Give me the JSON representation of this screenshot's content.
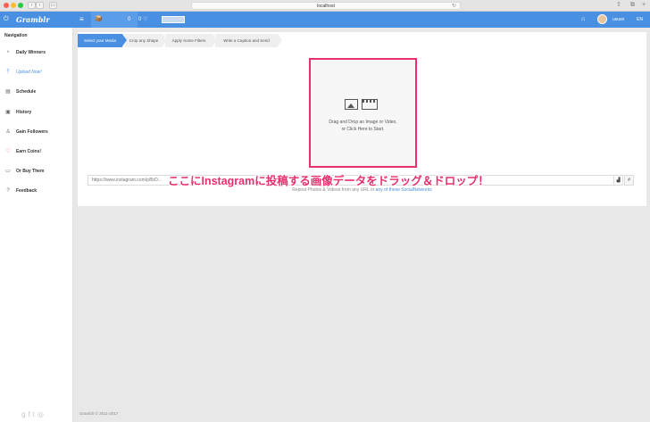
{
  "browser": {
    "url": "localhost"
  },
  "app": {
    "logo": "Gramblr",
    "count_badge": "0",
    "counter": "0 ♡",
    "user_name": "ususo",
    "lang": "EN"
  },
  "sidebar": {
    "title": "Navigation",
    "items": [
      {
        "label": "Daily Winners",
        "icon": "trophy-icon"
      },
      {
        "label": "Upload Now!",
        "icon": "upload-icon"
      },
      {
        "label": "Schedule",
        "icon": "calendar-icon"
      },
      {
        "label": "History",
        "icon": "history-icon"
      },
      {
        "label": "Gain Followers",
        "icon": "user-icon"
      },
      {
        "label": "Earn Coins!",
        "icon": "heart-icon"
      },
      {
        "label": "Or Buy Them",
        "icon": "card-icon"
      },
      {
        "label": "Feedback",
        "icon": "help-icon"
      }
    ]
  },
  "steps": [
    "Select your Media",
    "Crop any Shape",
    "Apply Some Filters",
    "Write a Caption and Send"
  ],
  "dropzone": {
    "line1": "Drag and Drop an Image or Video,",
    "line2": "or Click Here to Start."
  },
  "url_input": {
    "placeholder": "https://www.instagram.com/p/BrD..."
  },
  "repost": {
    "text": "Repost Photos & Videos from any URL or ",
    "link": "any of these SocialNetworks"
  },
  "overlay_text": "ここにInstagramに投稿する画像データをドラッグ＆ドロップ！",
  "footer": "Gramblr © 2011-2017",
  "colors": {
    "accent": "#4a90e2",
    "highlight": "#e8306d"
  }
}
